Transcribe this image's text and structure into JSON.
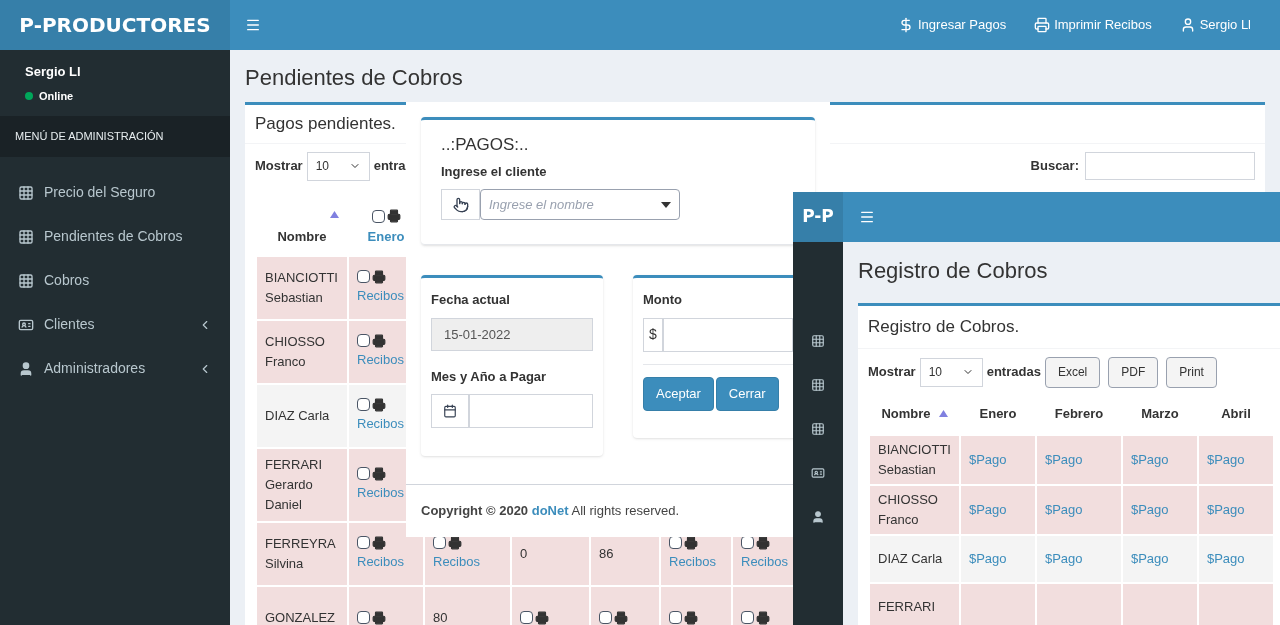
{
  "app": {
    "logo": "P-PRODUCTORES"
  },
  "sidebar": {
    "user": {
      "name": "Sergio Ll",
      "status": "Online"
    },
    "menu_header": "MENÚ DE ADMINISTRACIÓN",
    "items": [
      {
        "label": "Precio del Seguro",
        "kind": "page"
      },
      {
        "label": "Pendientes de Cobros",
        "kind": "page"
      },
      {
        "label": "Cobros",
        "kind": "page"
      },
      {
        "label": "Clientes",
        "kind": "submenu"
      },
      {
        "label": "Administradores",
        "kind": "submenu"
      }
    ]
  },
  "navbar": {
    "links": [
      {
        "label": "Ingresar Pagos"
      },
      {
        "label": "Imprimir Recibos"
      },
      {
        "label": "Sergio Ll"
      }
    ]
  },
  "page": {
    "title": "Pendientes de Cobros",
    "card_title": "Pagos pendientes.",
    "length_label": "Mostrar",
    "length_value": "10",
    "length_suffix": "entra",
    "search_label": "Buscar:",
    "table": {
      "columns": [
        {
          "label": "Nombre",
          "kind": "sort"
        },
        {
          "label": "Enero",
          "kind": "select",
          "checked": false
        }
      ],
      "rows": [
        {
          "highlighted": true,
          "cells": [
            {
              "kind": "name",
              "label": "BIANCIOTTI Sebastian"
            },
            {
              "kind": "receipt",
              "label": "Recibos",
              "checked": false
            }
          ]
        },
        {
          "highlighted": true,
          "cells": [
            {
              "kind": "name",
              "label": "CHIOSSO Franco"
            },
            {
              "kind": "receipt",
              "label": "Recibos",
              "checked": false
            }
          ]
        },
        {
          "highlighted": false,
          "cells": [
            {
              "kind": "name",
              "label": "DIAZ Carla"
            },
            {
              "kind": "receipt",
              "label": "Recibos",
              "checked": false
            }
          ]
        },
        {
          "highlighted": true,
          "cells": [
            {
              "kind": "name",
              "label": "FERRARI Gerardo Daniel"
            },
            {
              "kind": "receipt",
              "label": "Recibos",
              "checked": false
            }
          ]
        },
        {
          "highlighted": true,
          "cells": [
            {
              "kind": "name",
              "label": "FERREYRA Silvina"
            },
            {
              "kind": "receipt",
              "label": "Recibos",
              "checked": false
            },
            {
              "kind": "receipt",
              "label": "Recibos",
              "checked": false
            },
            {
              "kind": "amount",
              "label": "0"
            },
            {
              "kind": "amount",
              "label": "86"
            },
            {
              "kind": "receipt",
              "label": "Recibos",
              "checked": false
            },
            {
              "kind": "receipt",
              "label": "Recibos",
              "checked": false
            }
          ]
        },
        {
          "highlighted": true,
          "cells": [
            {
              "kind": "name",
              "label": "GONZALEZ"
            },
            {
              "kind": "receipt",
              "checked": false
            },
            {
              "kind": "amount",
              "label": "80"
            },
            {
              "kind": "receipt",
              "checked": false
            },
            {
              "kind": "receipt",
              "checked": false
            },
            {
              "kind": "receipt",
              "checked": false
            },
            {
              "kind": "receipt",
              "checked": false
            }
          ]
        }
      ]
    }
  },
  "modal": {
    "title": "..:PAGOS:..",
    "client_label": "Ingrese el cliente",
    "client_placeholder": "Ingrese el nombre",
    "date_label": "Fecha actual",
    "date_value": "15-01-2022",
    "period_label": "Mes y Año a Pagar",
    "amount_label": "Monto",
    "currency": "$",
    "buttons": [
      "Aceptar",
      "Cerrar"
    ],
    "footer": {
      "prefix": "Copyright © 2020",
      "link": "doNet",
      "suffix": "All rights reserved."
    }
  },
  "window2": {
    "logo": "P-P",
    "title": "Registro de Cobros",
    "card_title": "Registro de Cobros.",
    "length_label": "Mostrar",
    "length_value": "10",
    "length_suffix": "entradas",
    "export_buttons": [
      "Excel",
      "PDF",
      "Print"
    ],
    "table": {
      "columns": [
        {
          "label": "Nombre",
          "kind": "sort"
        },
        {
          "label": "Enero",
          "kind": "plain"
        },
        {
          "label": "Febrero",
          "kind": "plain"
        },
        {
          "label": "Marzo",
          "kind": "plain"
        },
        {
          "label": "Abril",
          "kind": "plain"
        }
      ],
      "rows": [
        {
          "highlighted": true,
          "cells": [
            "BIANCIOTTI Sebastian",
            "$Pago",
            "$Pago",
            "$Pago",
            "$Pago"
          ]
        },
        {
          "highlighted": true,
          "cells": [
            "CHIOSSO Franco",
            "$Pago",
            "$Pago",
            "$Pago",
            "$Pago"
          ]
        },
        {
          "highlighted": false,
          "cells": [
            "DIAZ Carla",
            "$Pago",
            "$Pago",
            "$Pago",
            "$Pago"
          ]
        },
        {
          "highlighted": true,
          "cells": [
            "FERRARI"
          ]
        }
      ]
    }
  }
}
